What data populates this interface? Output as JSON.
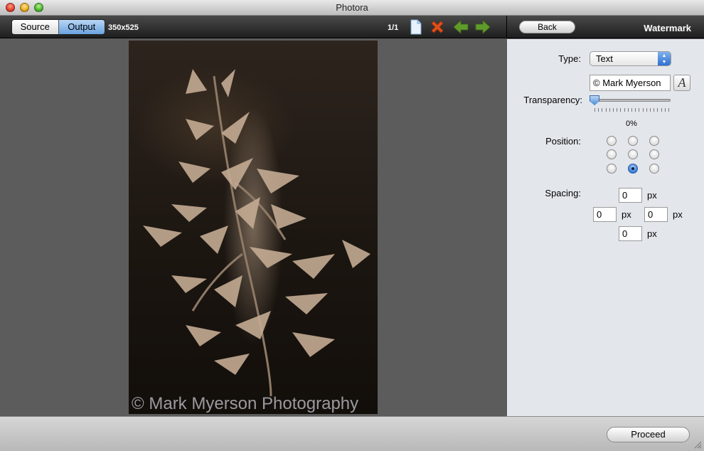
{
  "window": {
    "title": "Photora"
  },
  "toolbar": {
    "source_label": "Source",
    "output_label": "Output",
    "dimensions": "350x525",
    "page_counter": "1/1",
    "back_label": "Back",
    "panel_title": "Watermark"
  },
  "preview": {
    "watermark_text": "© Mark Myerson Photography"
  },
  "panel": {
    "type_label": "Type:",
    "type_value": "Text",
    "text_value": "© Mark Myerson",
    "font_button_glyph": "A",
    "transparency_label": "Transparency:",
    "transparency_value": "0%",
    "transparency_level": 0,
    "position_label": "Position:",
    "position_selected": "bottom-center",
    "spacing_label": "Spacing:",
    "spacing_top": "0",
    "spacing_left": "0",
    "spacing_right": "0",
    "spacing_bottom": "0",
    "unit": "px"
  },
  "footer": {
    "proceed_label": "Proceed"
  },
  "icons": {
    "document": "document-icon",
    "delete": "delete-x-icon",
    "previous": "arrow-left-icon",
    "next": "arrow-right-icon"
  },
  "colors": {
    "accent": "#3a7ad6",
    "delete": "#e0501a",
    "arrows": "#5f9a2a"
  }
}
